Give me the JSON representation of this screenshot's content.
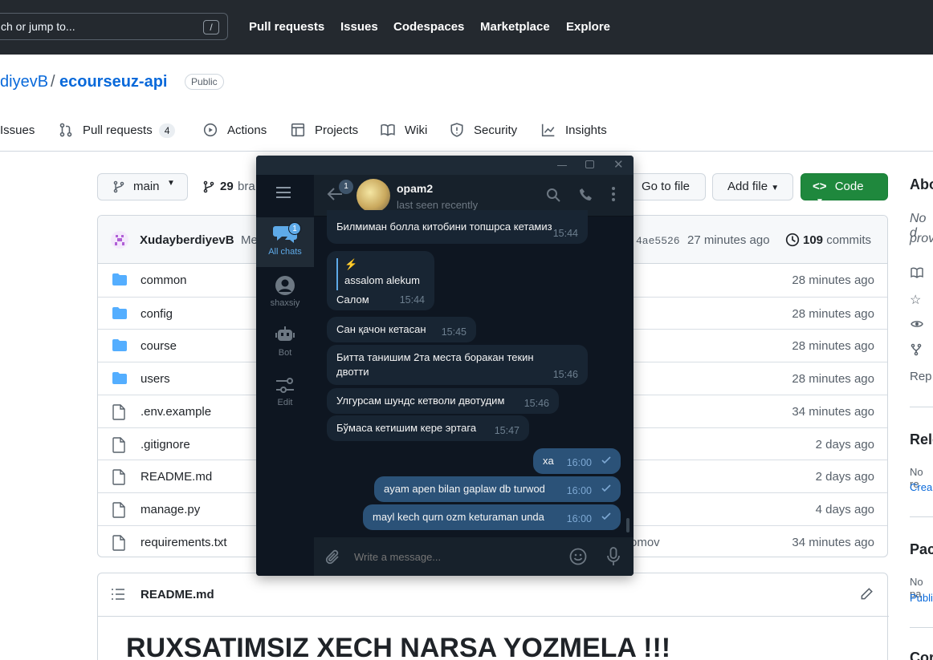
{
  "github": {
    "search": {
      "placeholder": "ch or jump to...",
      "slash": "/"
    },
    "nav": [
      "Pull requests",
      "Issues",
      "Codespaces",
      "Marketplace",
      "Explore"
    ],
    "repo": {
      "owner": "diyevB",
      "slash": "/",
      "name": "ecourseuz-api",
      "visibility": "Public"
    },
    "tabs": {
      "issues": "Issues",
      "pull_requests": "Pull requests",
      "pr_count": "4",
      "actions": "Actions",
      "projects": "Projects",
      "wiki": "Wiki",
      "security": "Security",
      "insights": "Insights"
    },
    "branch": {
      "name": "main",
      "count": "29",
      "count_label": "bra"
    },
    "buttons": {
      "go_to_file": "Go to file",
      "add_file": "Add file",
      "code": "Code"
    },
    "commit": {
      "author": "XudayberdiyevB",
      "message": "Me",
      "hash": "4ae5526",
      "time": "27 minutes ago",
      "commits_count": "109",
      "commits_label": "commits"
    },
    "files": [
      {
        "name": "common",
        "type": "folder",
        "time": "28 minutes ago"
      },
      {
        "name": "config",
        "type": "folder",
        "time": "28 minutes ago"
      },
      {
        "name": "course",
        "type": "folder",
        "time": "28 minutes ago"
      },
      {
        "name": "users",
        "type": "folder",
        "time": "28 minutes ago"
      },
      {
        "name": ".env.example",
        "type": "file",
        "time": "34 minutes ago"
      },
      {
        "name": ".gitignore",
        "type": "file",
        "time": "2 days ago"
      },
      {
        "name": "README.md",
        "type": "file",
        "time": "2 days ago"
      },
      {
        "name": "manage.py",
        "type": "file",
        "time": "4 days ago"
      },
      {
        "name": "requirements.txt",
        "type": "file",
        "time": "34 minutes ago",
        "commit_fragment": "omov"
      }
    ],
    "readme": {
      "filename": "README.md",
      "heading": "RUXSATIMSIZ XECH NARSA YOZMELA !!!"
    },
    "sidebar": {
      "about": "Abo",
      "desc1": "No d",
      "desc2": "prov",
      "readme": "Rep",
      "releases": "Rele",
      "releases_none": "No re",
      "releases_create": "Crea",
      "packages": "Pac",
      "packages_none": "No pa",
      "packages_publish": "Publi",
      "contributors": "Cor"
    }
  },
  "telegram": {
    "sidebar": {
      "all_chats": "All chats",
      "all_chats_badge": "1",
      "personal": "shaxsiy",
      "bot": "Bot",
      "edit": "Edit"
    },
    "chat": {
      "name": "opam2",
      "status": "last seen recently",
      "back_badge": "1"
    },
    "messages_in": [
      {
        "text": "Билмиман болла китобини топшрса кетамиз",
        "time": "15:44"
      },
      {
        "reply_icon": "⚡",
        "reply_text": "assalom alekum",
        "text": "Салом",
        "time": "15:44"
      },
      {
        "text": "Сан қачон кетасан",
        "time": "15:45"
      },
      {
        "text": "Битта танишим 2та места боракан  текин двотти",
        "time": "15:46"
      },
      {
        "text": "Улгурсам шундс кетволи двотудим",
        "time": "15:46"
      },
      {
        "text": "Бўмаса кетишим кере эртага",
        "time": "15:47"
      }
    ],
    "messages_out": [
      {
        "text": "xa",
        "time": "16:00"
      },
      {
        "text": "ayam apen bilan gaplaw db turwod",
        "time": "16:00"
      },
      {
        "text": "mayl kech qurn ozm keturaman unda",
        "time": "16:00"
      }
    ],
    "input": {
      "placeholder": "Write a message..."
    },
    "colors": {
      "outgoing": "#2b5278",
      "incoming": "#182533",
      "accent": "#5eaae8"
    }
  }
}
